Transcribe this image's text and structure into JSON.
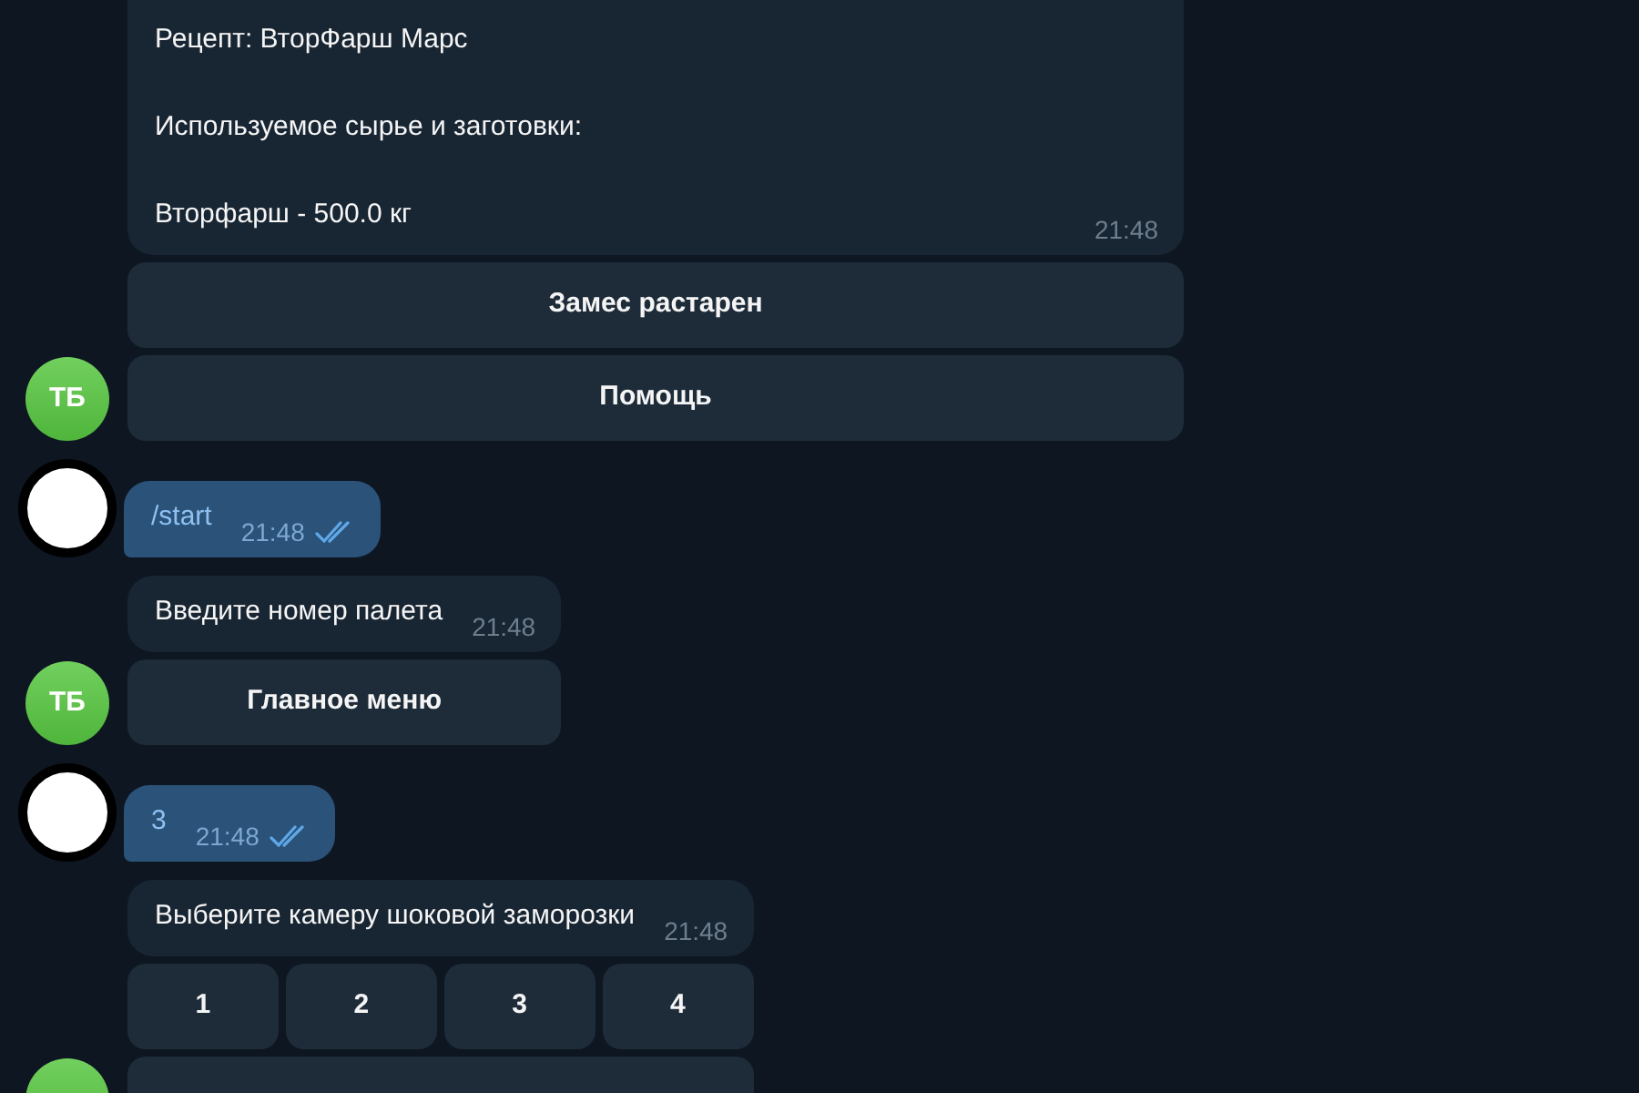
{
  "chat": [
    {
      "kind": "incoming",
      "message": {
        "paragraphs": [
          [
            {
              "text": "Рецепт: ВторФарш Марс"
            }
          ],
          [
            {
              "text": "Используемое сырье и заготовки:"
            }
          ],
          [
            {
              "text": "Вторфарш - 500.0 кг"
            }
          ]
        ],
        "time": "21:48"
      },
      "avatar": "ТБ",
      "keyboard": [
        [
          {
            "label": "Замес растарен"
          }
        ],
        [
          {
            "label": "Помощь"
          }
        ]
      ]
    },
    {
      "kind": "outgoing",
      "message": {
        "paragraphs": [
          [
            {
              "text": "/start"
            }
          ]
        ],
        "time": "21:48",
        "read": true
      }
    },
    {
      "kind": "incoming",
      "message": {
        "paragraphs": [
          [
            {
              "text": "Введите номер палета"
            }
          ]
        ],
        "time": "21:48"
      },
      "avatar": "ТБ",
      "keyboard": [
        [
          {
            "label": "Главное меню"
          }
        ]
      ]
    },
    {
      "kind": "outgoing",
      "message": {
        "paragraphs": [
          [
            {
              "text": "3"
            }
          ]
        ],
        "time": "21:48",
        "read": true
      }
    },
    {
      "kind": "incoming",
      "message": {
        "paragraphs": [
          [
            {
              "text": "Выберите камеру шоковой заморозки"
            }
          ]
        ],
        "time": "21:48"
      },
      "keyboard": [
        [
          {
            "label": "1"
          },
          {
            "label": "2"
          },
          {
            "label": "3"
          },
          {
            "label": "4"
          }
        ]
      ],
      "more_buttons_below": true
    }
  ]
}
